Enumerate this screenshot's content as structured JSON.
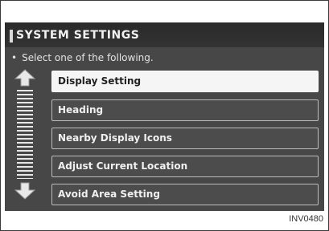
{
  "screen": {
    "title": "SYSTEM SETTINGS",
    "instruction_bullet": "•",
    "instruction": "Select one of the following.",
    "menu": {
      "items": [
        {
          "label": "Display Setting",
          "selected": true
        },
        {
          "label": "Heading",
          "selected": false
        },
        {
          "label": "Nearby Display Icons",
          "selected": false
        },
        {
          "label": "Adjust Current Location",
          "selected": false
        },
        {
          "label": "Avoid Area Setting",
          "selected": false
        }
      ]
    },
    "scroll_icons": {
      "up": "scroll-up-arrow-icon",
      "down": "scroll-down-arrow-icon"
    }
  },
  "caption": "INV0480",
  "colors": {
    "screen_bg": "#474747",
    "title_bar_bg": "#2a2a2a",
    "selected_item_bg": "#f5f5f5",
    "item_bg": "#4c4c4c",
    "item_border": "#bdbdbd"
  }
}
